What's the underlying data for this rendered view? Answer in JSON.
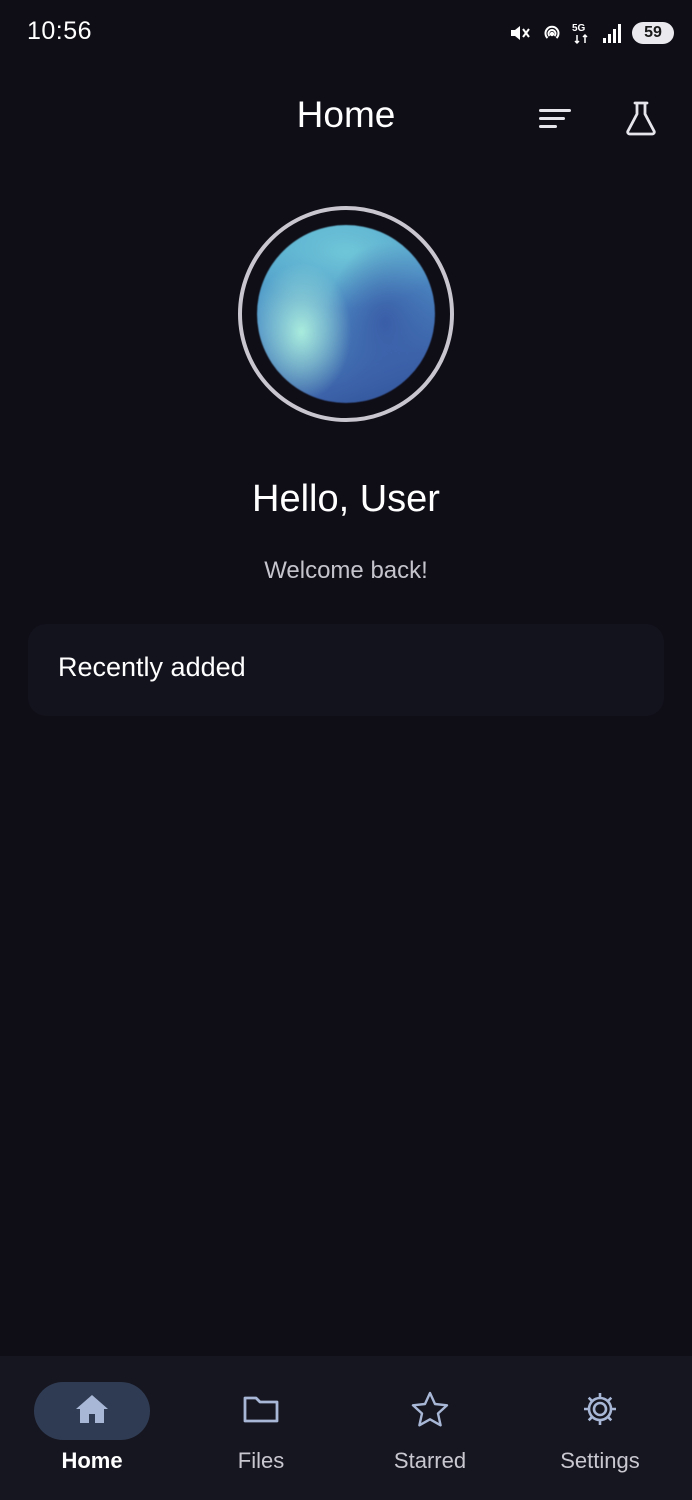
{
  "status_bar": {
    "time": "10:56",
    "battery": "59",
    "icons": [
      "mute-icon",
      "hotspot-icon",
      "5g-icon",
      "signal-icon",
      "battery-icon"
    ]
  },
  "top_bar": {
    "title": "Home",
    "actions": [
      "menu-icon",
      "flask-icon"
    ]
  },
  "profile": {
    "greeting": "Hello, User",
    "subtitle": "Welcome back!"
  },
  "recent": {
    "title": "Recently added"
  },
  "bottom_nav": {
    "items": [
      {
        "label": "Home",
        "icon": "home-icon",
        "active": true
      },
      {
        "label": "Files",
        "icon": "folder-icon",
        "active": false
      },
      {
        "label": "Starred",
        "icon": "star-icon",
        "active": false
      },
      {
        "label": "Settings",
        "icon": "gear-icon",
        "active": false
      }
    ]
  },
  "colors": {
    "background": "#0f0d16",
    "card": "#13131d",
    "nav_bar": "#161620",
    "active_pill": "#2f3b52",
    "icon": "#a8b7d6"
  }
}
